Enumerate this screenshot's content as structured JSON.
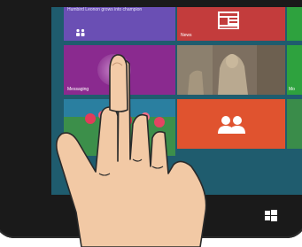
{
  "start_screen": {
    "tiles": [
      {
        "id": "top-ticker",
        "text": "Humbird Leonon grows into champion"
      },
      {
        "id": "news",
        "label": "News",
        "icon": "newspaper-icon"
      },
      {
        "id": "messaging",
        "label": "Messaging"
      },
      {
        "id": "photo",
        "label": ""
      },
      {
        "id": "green-mid",
        "label": "Mo"
      },
      {
        "id": "people",
        "label": "",
        "icon": "people-icon"
      }
    ]
  },
  "device": {
    "start_button_icon": "windows-logo-icon"
  },
  "colors": {
    "screen_bg": "#1f5c6e",
    "purple": "#6a4fb4",
    "messaging": "#8a2a8f",
    "news_red": "#c33c3c",
    "people_orange": "#e0532f",
    "green": "#2ea23e",
    "bezel": "#1a1a1a",
    "skin": "#f2c9a5"
  }
}
